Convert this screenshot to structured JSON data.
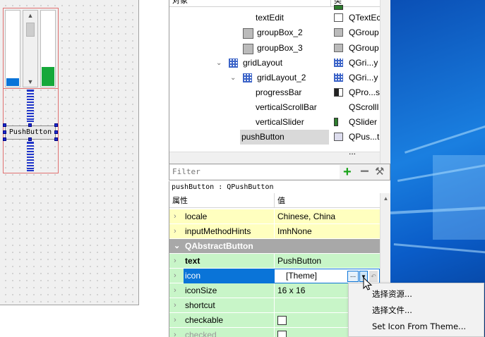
{
  "object_inspector": {
    "columns": {
      "object": "对象",
      "class": "类"
    },
    "rows": [
      {
        "name": "textEdit",
        "class": "QTextEc",
        "indent": 122,
        "icon": "textedit-icon"
      },
      {
        "name": "groupBox_2",
        "class": "QGroup",
        "indent": 124,
        "icon": "groupbox-broken-icon"
      },
      {
        "name": "groupBox_3",
        "class": "QGroup",
        "indent": 124,
        "icon": "groupbox-broken-icon"
      },
      {
        "name": "gridLayout",
        "class": "QGri...y",
        "indent": 104,
        "icon": "grid-layout-icon",
        "expand": "⌄"
      },
      {
        "name": "gridLayout_2",
        "class": "QGri...y",
        "indent": 124,
        "icon": "grid-layout-icon",
        "expand": "⌄"
      },
      {
        "name": "progressBar",
        "class": "QPro...s",
        "indent": 122,
        "icon": "progressbar-icon"
      },
      {
        "name": "verticalScrollBar",
        "class": "QScrollI",
        "indent": 122,
        "icon": "scrollbar-icon"
      },
      {
        "name": "verticalSlider",
        "class": "QSlider",
        "indent": 122,
        "icon": "slider-icon"
      },
      {
        "name": "pushButton",
        "class": "QPus...t",
        "indent": 102,
        "icon": "pushbutton-icon",
        "selected": true
      },
      {
        "name": "...",
        "class": "...",
        "indent": 122,
        "icon": ""
      }
    ]
  },
  "filter": {
    "placeholder": "Filter"
  },
  "selected_object": "pushButton : QPushButton",
  "property_editor": {
    "columns": {
      "property": "属性",
      "value": "值"
    },
    "rows": [
      {
        "name": "locale",
        "value": "Chinese, China",
        "style": "yellow"
      },
      {
        "name": "inputMethodHints",
        "value": "ImhNone",
        "style": "yellow"
      },
      {
        "name": "QAbstractButton",
        "value": "",
        "style": "group"
      },
      {
        "name": "text",
        "value": "PushButton",
        "style": "green",
        "bold": true
      },
      {
        "name": "icon",
        "value": "[Theme]",
        "style": "selected"
      },
      {
        "name": "iconSize",
        "value": "16 x 16",
        "style": "green"
      },
      {
        "name": "shortcut",
        "value": "",
        "style": "green"
      },
      {
        "name": "checkable",
        "value": "",
        "style": "green",
        "checkbox": true
      },
      {
        "name": "checked",
        "value": "",
        "style": "green",
        "checkbox": true
      }
    ],
    "icon_more_label": "...",
    "icon_drop_label": "▼"
  },
  "canvas": {
    "pushbutton_text": "PushButton",
    "progress_value": 0.1,
    "slider_value": 0.25
  },
  "context_menu": {
    "items": [
      "选择资源...",
      "选择文件...",
      "Set Icon From Theme..."
    ]
  },
  "colors": {
    "accent": "#0a74d8",
    "property_yellow": "#ffffbf",
    "property_green": "#c8f5c8",
    "group_gray": "#a8a8a8"
  }
}
